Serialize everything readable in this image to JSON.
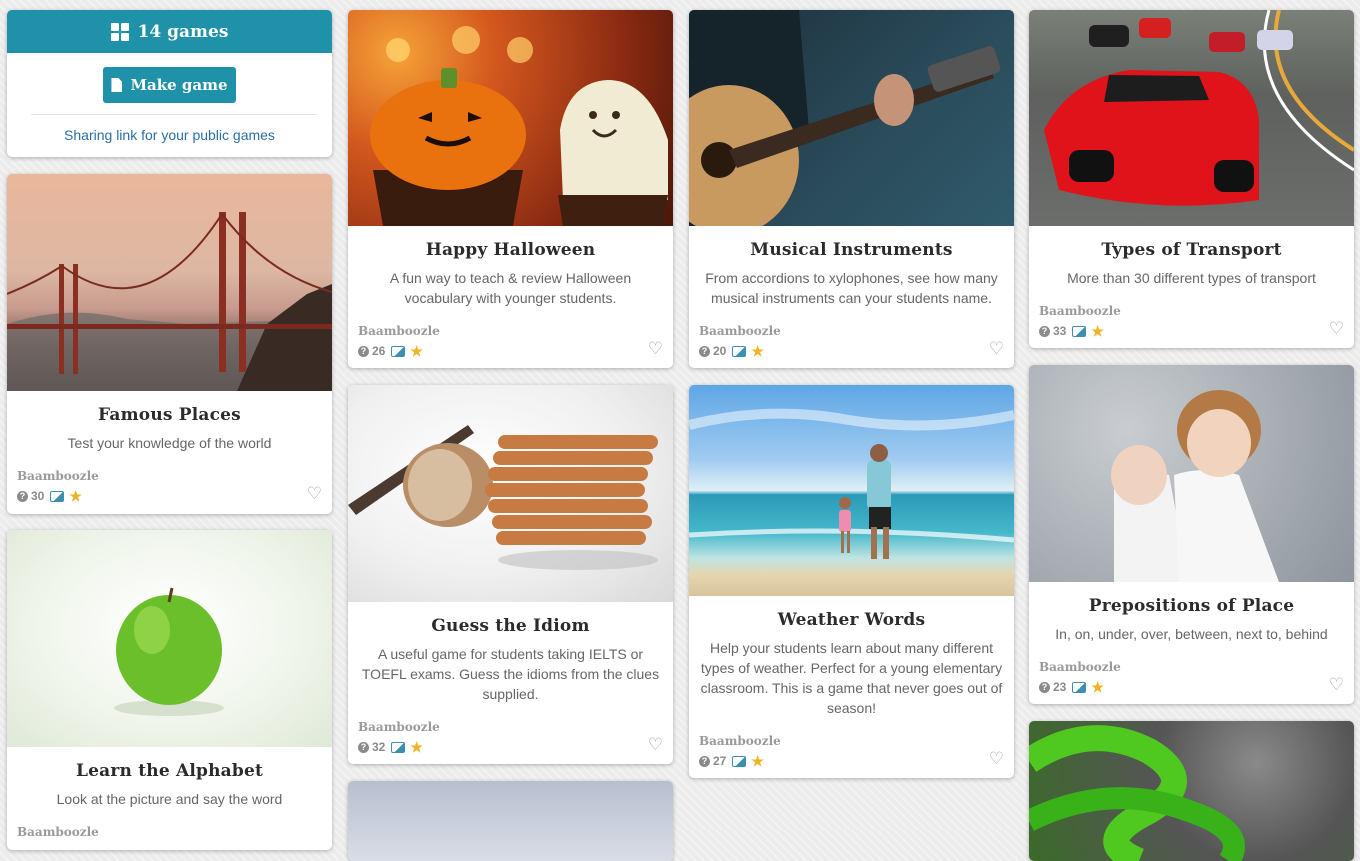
{
  "panel": {
    "games_count": "14 games",
    "make_game_label": "Make game",
    "sharing_link": "Sharing link for your public games"
  },
  "cards": [
    {
      "title": "Famous Places",
      "desc": "Test your knowledge of the world",
      "author": "Baamboozle",
      "questions": "30"
    },
    {
      "title": "Learn the Alphabet",
      "desc": "Look at the picture and say the word",
      "author": "Baamboozle"
    },
    {
      "title": "Happy Halloween",
      "desc": "A fun way to teach & review Halloween vocabulary with younger students.",
      "author": "Baamboozle",
      "questions": "26"
    },
    {
      "title": "Guess the Idiom",
      "desc": "A useful game for students taking IELTS or TOEFL exams. Guess the idioms from the clues supplied.",
      "author": "Baamboozle",
      "questions": "32"
    },
    {
      "title": "Musical Instruments",
      "desc": "From accordions to xylophones, see how many musical instruments can your students name.",
      "author": "Baamboozle",
      "questions": "20"
    },
    {
      "title": "Weather Words",
      "desc": "Help your students learn about many different types of weather. Perfect for a young elementary classroom. This is a game that never goes out of season!",
      "author": "Baamboozle",
      "questions": "27"
    },
    {
      "title": "Types of Transport",
      "desc": "More than 30 different types of transport",
      "author": "Baamboozle",
      "questions": "33"
    },
    {
      "title": "Prepositions of Place",
      "desc": "In, on, under, over, between, next to, behind",
      "author": "Baamboozle",
      "questions": "23"
    }
  ],
  "icons": {
    "heart": "♡",
    "star": "★",
    "question": "?"
  },
  "colors": {
    "accent": "#1f91a8",
    "link": "#2a6fa5",
    "star": "#f0b323"
  }
}
